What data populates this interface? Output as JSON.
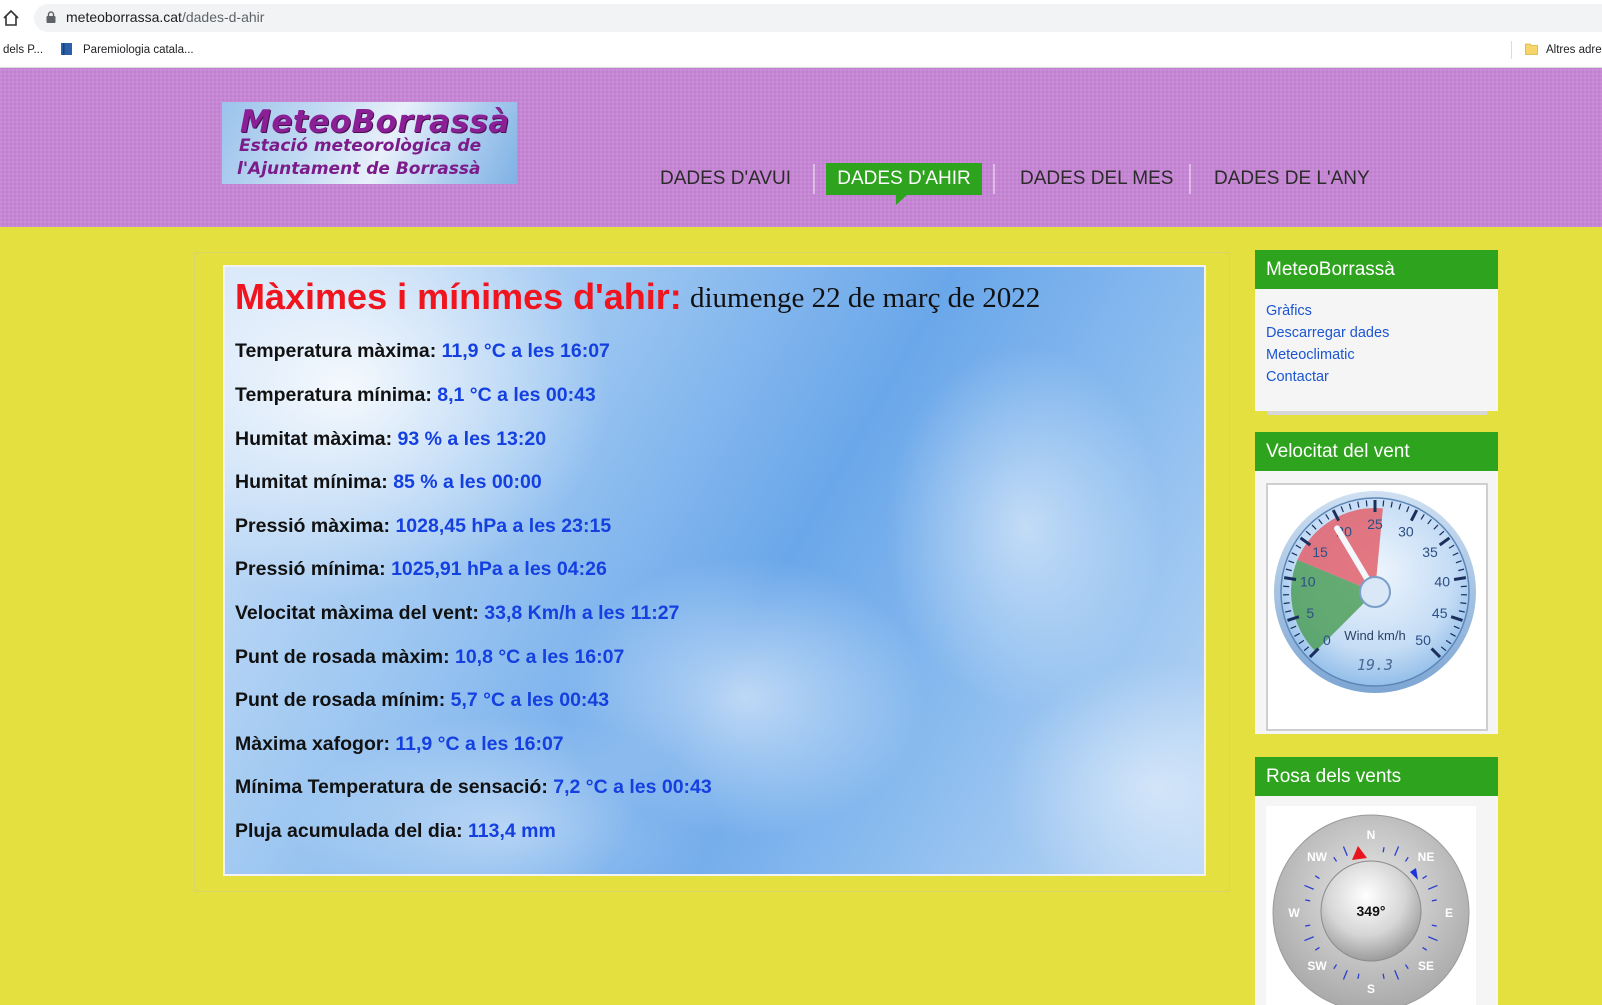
{
  "browser": {
    "url_domain": "meteoborrassa.cat",
    "url_path": "/dades-d-ahir",
    "bookmarks": [
      "dels P...",
      "Paremiologia catala..."
    ],
    "other_bookmarks": "Altres adre"
  },
  "header": {
    "logo": {
      "title": "MeteoBorrassà",
      "line1": "Estació meteorològica de",
      "line2": "l'Ajuntament de Borrassà"
    },
    "nav": [
      {
        "label": "DADES D'AVUI",
        "active": false
      },
      {
        "label": "DADES D'AHIR",
        "active": true
      },
      {
        "label": "DADES DEL MES",
        "active": false
      },
      {
        "label": "DADES DE L'ANY",
        "active": false
      }
    ]
  },
  "main": {
    "title": "Màximes i mínimes d'ahir:",
    "date": "diumenge 22 de març de 2022",
    "rows": [
      {
        "label": "Temperatura màxima:",
        "value": "11,9 °C a les 16:07"
      },
      {
        "label": "Temperatura mínima:",
        "value": "8,1 °C a les 00:43"
      },
      {
        "label": "Humitat màxima:",
        "value": "93 % a les 13:20"
      },
      {
        "label": "Humitat mínima:",
        "value": "85 % a les 00:00"
      },
      {
        "label": "Pressió màxima:",
        "value": "1028,45 hPa a les 23:15"
      },
      {
        "label": "Pressió mínima:",
        "value": "1025,91 hPa a les 04:26"
      },
      {
        "label": "Velocitat màxima del vent:",
        "value": "33,8 Km/h a les 11:27"
      },
      {
        "label": "Punt de rosada màxim:",
        "value": "10,8 °C a les 16:07"
      },
      {
        "label": "Punt de rosada mínim:",
        "value": "5,7 °C a les 00:43"
      },
      {
        "label": "Màxima xafogor:",
        "value": "11,9 °C a les 16:07"
      },
      {
        "label": "Mínima Temperatura de sensació:",
        "value": "7,2 °C a les 00:43"
      },
      {
        "label": "Pluja acumulada del dia:",
        "value": "113,4 mm"
      }
    ]
  },
  "sidebar": {
    "menu": {
      "title": "MeteoBorrassà",
      "links": [
        "Gràfics",
        "Descarregar dades",
        "Meteoclimatic",
        "Contactar"
      ]
    },
    "wind_speed": {
      "title": "Velocitat del vent",
      "gauge_label": "Wind km/h",
      "reading": "19.3",
      "scale": [
        "0",
        "5",
        "10",
        "15",
        "20",
        "25",
        "30",
        "35",
        "40",
        "45",
        "50"
      ],
      "value": 19.3,
      "range": [
        0,
        50
      ]
    },
    "wind_rose": {
      "title": "Rosa dels vents",
      "reading": "349°",
      "directions": [
        "N",
        "NE",
        "E",
        "SE",
        "S",
        "SW",
        "W",
        "NW"
      ]
    }
  },
  "colors": {
    "page_bg": "#e3e040",
    "header_bg": "#c785d6",
    "accent_green": "#2ea31d",
    "title_red": "#f0141e",
    "value_blue": "#1440e0",
    "link_blue": "#1b55d1"
  }
}
